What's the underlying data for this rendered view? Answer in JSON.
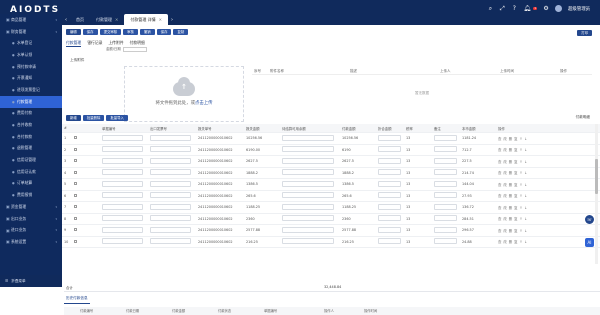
{
  "app": {
    "brand": "AIODTS"
  },
  "tabs": [
    {
      "label": "首页",
      "active": false,
      "closable": false
    },
    {
      "label": "付款管理",
      "active": false,
      "closable": true
    },
    {
      "label": "付款管理 详情",
      "active": true,
      "closable": true
    }
  ],
  "topbar": {
    "user_name": "超级管理员",
    "notification_count": "1"
  },
  "sidebar": {
    "items": [
      {
        "label": "商品管理",
        "level": 0,
        "icon": "box-icon"
      },
      {
        "label": "财务管理",
        "level": 0,
        "icon": "yen-icon"
      },
      {
        "label": "水单登记",
        "level": 1
      },
      {
        "label": "水单认领",
        "level": 1
      },
      {
        "label": "预付款申请",
        "level": 1
      },
      {
        "label": "开票通知",
        "level": 1
      },
      {
        "label": "进项发票登记",
        "level": 1
      },
      {
        "label": "付款管理",
        "level": 1,
        "active": true
      },
      {
        "label": "费用付款",
        "level": 1
      },
      {
        "label": "合并收款",
        "level": 1
      },
      {
        "label": "合付款款",
        "level": 1
      },
      {
        "label": "退税管理",
        "level": 1
      },
      {
        "label": "信用证管理",
        "level": 1
      },
      {
        "label": "信用证认款",
        "level": 1
      },
      {
        "label": "订单结算",
        "level": 1
      },
      {
        "label": "费用报销",
        "level": 1
      },
      {
        "label": "资金管理",
        "level": 0,
        "icon": "wallet-icon"
      },
      {
        "label": "出口业务",
        "level": 0,
        "icon": "export-icon"
      },
      {
        "label": "进口业务",
        "level": 0,
        "icon": "import-icon"
      },
      {
        "label": "系统设置",
        "level": 0,
        "icon": "gear-icon"
      }
    ],
    "footer_label": "折叠菜单"
  },
  "toolbar": {
    "buttons": [
      "编辑",
      "保存",
      "提交审核",
      "审核",
      "撤销",
      "保存",
      "复制"
    ],
    "right_button": "打印"
  },
  "subtabs": {
    "items": [
      "付款管理",
      "银行记录",
      "上传附件",
      "付款明细"
    ],
    "active_index": 0,
    "filter_label": "金额/日期"
  },
  "upload": {
    "section_label": "上传附件",
    "prompt": "将文件拖到此处，或",
    "link": "点击上传"
  },
  "files": {
    "headers": [
      "序号",
      "附件名称",
      "描述",
      "上传人",
      "上传时间",
      "操作"
    ],
    "empty_text": "暂无数据"
  },
  "payment": {
    "buttons": [
      "新增",
      "批量删除",
      "批量导入"
    ],
    "title": "付款明细"
  },
  "grid": {
    "headers": [
      "#",
      "",
      "单据编号",
      "出口发票号",
      "报关单号",
      "报关金额",
      "待结算可用余额",
      "付款金额",
      "折合金额",
      "税率",
      "备注",
      "本币金额",
      "操作"
    ],
    "rows": [
      {
        "no": "1",
        "doc": "2411200000010602",
        "declared": "10256.56",
        "pay": "10256.56",
        "rate": "13",
        "amount": "1181.24"
      },
      {
        "no": "2",
        "doc": "2411200000010602",
        "declared": "6190.00",
        "pay": "6190",
        "rate": "13",
        "amount": "712.7"
      },
      {
        "no": "3",
        "doc": "2411200000010602",
        "declared": "2627.5",
        "pay": "2627.5",
        "rate": "13",
        "amount": "227.5"
      },
      {
        "no": "4",
        "doc": "2411200000010602",
        "declared": "1888.2",
        "pay": "1888.2",
        "rate": "13",
        "amount": "214.74"
      },
      {
        "no": "5",
        "doc": "2411200000010602",
        "declared": "1386.5",
        "pay": "1386.5",
        "rate": "13",
        "amount": "144.04"
      },
      {
        "no": "6",
        "doc": "2411200000010602",
        "declared": "265.6",
        "pay": "265.6",
        "rate": "13",
        "amount": "27.93"
      },
      {
        "no": "7",
        "doc": "2411200000010602",
        "declared": "1188.25",
        "pay": "1188.25",
        "rate": "13",
        "amount": "136.72"
      },
      {
        "no": "8",
        "doc": "2411200000010602",
        "declared": "2360",
        "pay": "2360",
        "rate": "13",
        "amount": "284.51"
      },
      {
        "no": "9",
        "doc": "2411200000010602",
        "declared": "2577.88",
        "pay": "2577.88",
        "rate": "13",
        "amount": "296.57"
      },
      {
        "no": "10",
        "doc": "2411200000010602",
        "declared": "216.25",
        "pay": "216.25",
        "rate": "13",
        "amount": "24.88"
      }
    ],
    "op_labels": [
      "查",
      "改",
      "删",
      "复",
      "↑",
      "↓"
    ],
    "totals_label": "合计",
    "totals_pay": "32,448.84"
  },
  "history": {
    "tab_label": "历史付款信息",
    "headers": [
      "",
      "付款编号",
      "付款日期",
      "付款金额",
      "付款状态",
      "单据编号",
      "操作人",
      "操作时间"
    ]
  },
  "floats": [
    "AI"
  ]
}
